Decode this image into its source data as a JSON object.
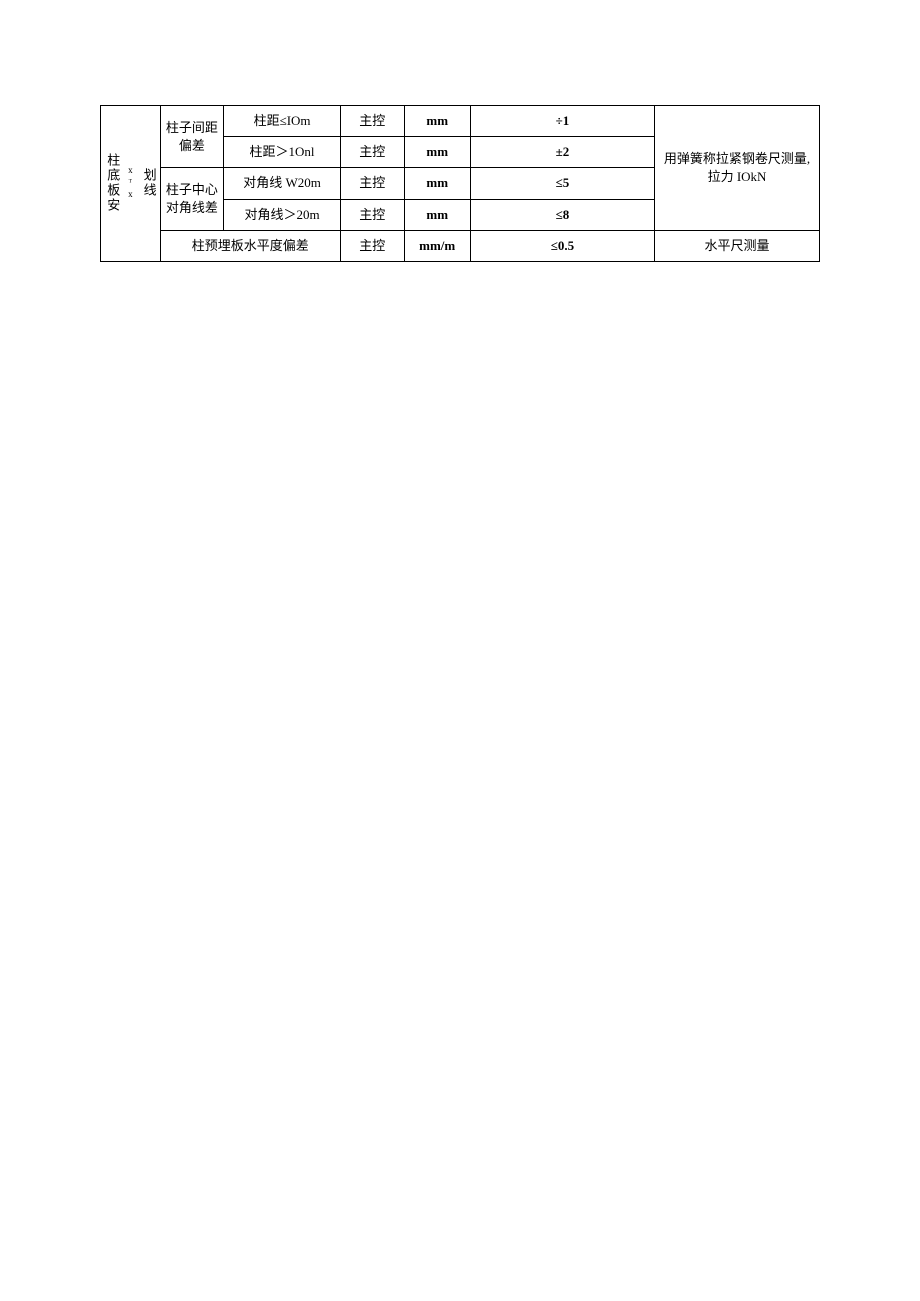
{
  "table": {
    "rowHeaderMain": "划线",
    "rowHeaderSub": "xᵀx",
    "rowHeaderTail": "柱底板安",
    "group1": "柱子间距偏差",
    "group2": "柱子中心对角线差",
    "rows": [
      {
        "cond": "柱距≤IOm",
        "ctrl": "主控",
        "unit": "mm",
        "val": "÷1"
      },
      {
        "cond": "柱距＞1Onl",
        "ctrl": "主控",
        "unit": "mm",
        "val": "±2"
      },
      {
        "cond": "对角线 W20m",
        "ctrl": "主控",
        "unit": "mm",
        "val": "≤5"
      },
      {
        "cond": "对角线＞20m",
        "ctrl": "主控",
        "unit": "mm",
        "val": "≤8"
      },
      {
        "cond": "柱预埋板水平度偏差",
        "ctrl": "主控",
        "unit": "mm/m",
        "val": "≤0.5"
      }
    ],
    "note1": "用弹簧称拉紧钢卷尺测量, 拉力 IOkN",
    "note2": "水平尺测量"
  }
}
